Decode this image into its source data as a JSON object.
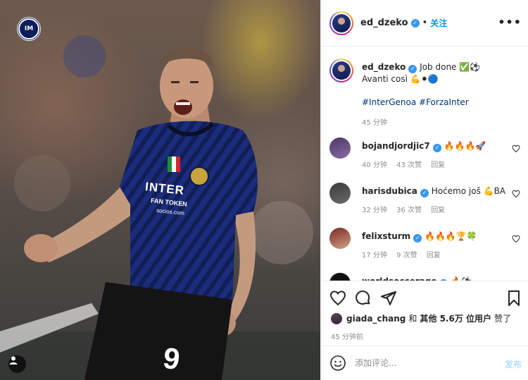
{
  "photo": {
    "badge_text": "IM",
    "jersey_sponsor": "INTER",
    "jersey_sub": "FAN TOKEN",
    "jersey_sub2": "socios.com",
    "shorts_number": "9"
  },
  "header": {
    "username": "ed_dzeko",
    "separator": "•",
    "follow_label": "关注",
    "more_label": "•••"
  },
  "caption": {
    "username": "ed_dzeko",
    "line1": "Job done ✅⚽",
    "line2": "Avanti così 💪⚫🔵",
    "hashtags": "#InterGenoa #ForzaInter",
    "time": "45 分钟"
  },
  "comments": [
    {
      "username": "bojandjordjic7",
      "text": "🔥🔥🔥🚀",
      "time": "40 分钟",
      "likes": "43 次赞",
      "reply": "回复"
    },
    {
      "username": "harisdubica",
      "text": "Hoćemo još 💪BA",
      "time": "32 分钟",
      "likes": "36 次赞",
      "reply": "回复"
    },
    {
      "username": "felixsturm",
      "text": "🔥🔥🔥🏆🍀",
      "time": "17 分钟",
      "likes": "9 次赞",
      "reply": "回复"
    },
    {
      "username": "worldsoccerage",
      "text": "🔥⚽",
      "time": "",
      "likes": "",
      "reply": ""
    }
  ],
  "actions": {
    "liker": "giada_chang",
    "and": "和",
    "others": "其他 5.6万 位用户",
    "liked": "赞了",
    "post_time": "45 分钟前"
  },
  "add_comment": {
    "placeholder": "添加评论...",
    "post_label": "发布"
  }
}
